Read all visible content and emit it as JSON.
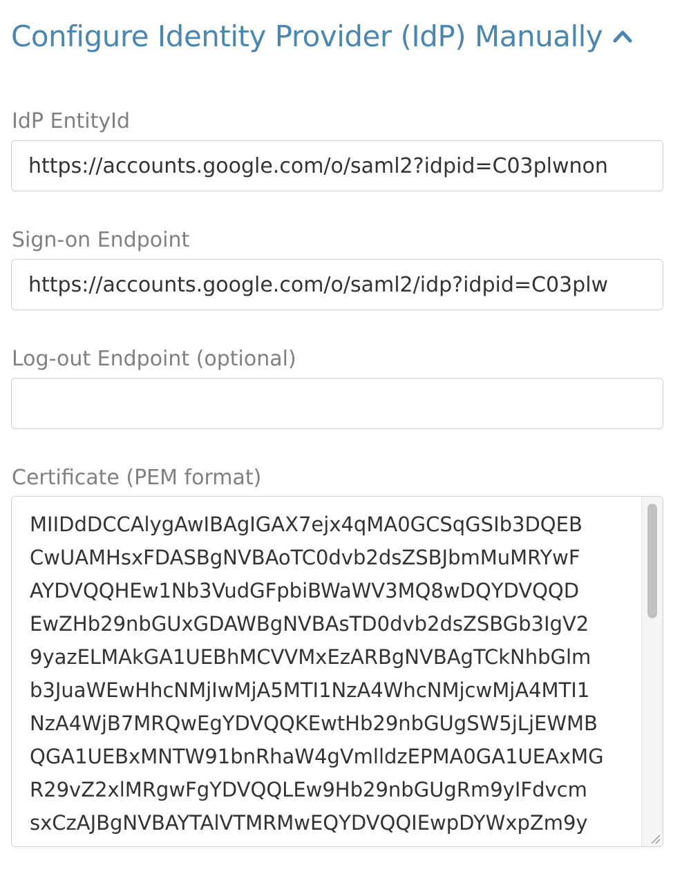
{
  "section": {
    "title": "Configure Identity Provider (IdP) Manually",
    "toggle_icon": "chevron-up-icon"
  },
  "fields": {
    "entity_id": {
      "label": "IdP EntityId",
      "value": "https://accounts.google.com/o/saml2?idpid=C03plwnon"
    },
    "sign_on": {
      "label": "Sign-on Endpoint",
      "value": "https://accounts.google.com/o/saml2/idp?idpid=C03plw"
    },
    "log_out": {
      "label": "Log-out Endpoint (optional)",
      "value": ""
    },
    "certificate": {
      "label": "Certificate (PEM format)",
      "value": "MIIDdDCCAlygAwIBAgIGAX7ejx4qMA0GCSqGSIb3DQEB\nCwUAMHsxFDASBgNVBAoTC0dvb2dsZSBJbmMuMRYwF\nAYDVQQHEw1Nb3VudGFpbiBWaWV3MQ8wDQYDVQQD\nEwZHb29nbGUxGDAWBgNVBAsTD0dvb2dsZSBGb3IgV2\n9yazELMAkGA1UEBhMCVVMxEzARBgNVBAgTCkNhbGlm\nb3JuaWEwHhcNMjIwMjA5MTI1NzA4WhcNMjcwMjA4MTI1\nNzA4WjB7MRQwEgYDVQQKEwtHb29nbGUgSW5jLjEWMB\nQGA1UEBxMNTW91bnRhaW4gVmlldzEPMA0GA1UEAxMG\nR29vZ2xlMRgwFgYDVQQLEw9Hb29nbGUgRm9yIFdvcm\nsxCzAJBgNVBAYTAlVTMRMwEQYDVQQIEwpDYWxpZm9y"
    }
  },
  "icons": {
    "scroll": "scrollbar-thumb",
    "resize": "resize-handle-icon"
  },
  "colors": {
    "title": "#4a86b0",
    "label": "#808080",
    "border": "#cfcfcf",
    "text": "#333333"
  }
}
